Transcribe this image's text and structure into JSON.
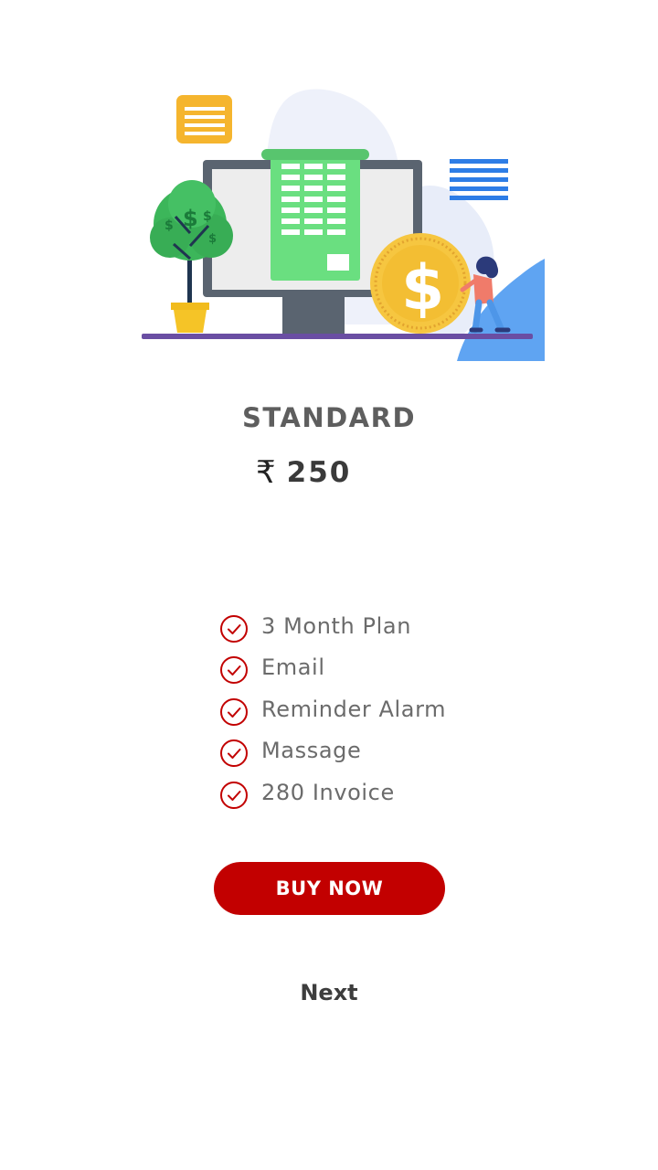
{
  "plan": {
    "title": "STANDARD",
    "currency_symbol": "₹",
    "price": "250"
  },
  "features": [
    {
      "label": "3 Month Plan",
      "icon": "check-circle-icon"
    },
    {
      "label": "Email",
      "icon": "check-circle-icon"
    },
    {
      "label": "Reminder Alarm",
      "icon": "check-circle-icon"
    },
    {
      "label": "Massage",
      "icon": "check-circle-icon"
    },
    {
      "label": "280 Invoice",
      "icon": "check-circle-icon"
    }
  ],
  "actions": {
    "buy_label": "BUY NOW",
    "next_label": "Next"
  },
  "colors": {
    "accent": "#c20000",
    "title_text": "#5e5e5e",
    "feature_text": "#6b6b6b"
  }
}
